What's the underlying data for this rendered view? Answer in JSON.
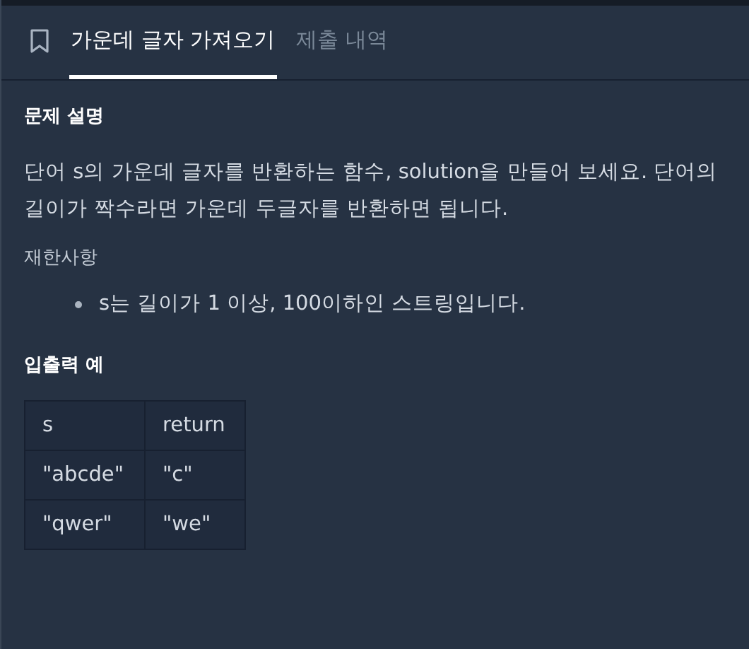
{
  "tabs": [
    {
      "label": "가운데 글자 가져오기",
      "selected": true
    },
    {
      "label": "제출 내역",
      "selected": false
    }
  ],
  "description": {
    "heading": "문제 설명",
    "text": "단어 s의 가운데 글자를 반환하는 함수, solution을 만들어 보세요. 단어의 길이가 짝수라면 가운데 두글자를 반환하면 됩니다."
  },
  "constraints": {
    "heading": "재한사항",
    "items": [
      "s는 길이가 1 이상, 100이하인 스트링입니다."
    ]
  },
  "examples": {
    "heading": "입출력 예",
    "columns": [
      "s",
      "return"
    ],
    "rows": [
      [
        "\"abcde\"",
        "\"c\""
      ],
      [
        "\"qwer\"",
        "\"we\""
      ]
    ]
  }
}
